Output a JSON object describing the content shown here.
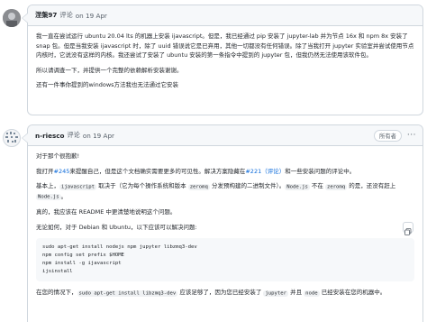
{
  "comment1": {
    "author": "涅槃97",
    "meta": "评论",
    "date": "on 19 Apr",
    "paragraphs": [
      "我一直在尝试运行 ubuntu 20.04 lts 的机器上安装 ijavascript。但是，我已经通过 pip 安装了 jupyter-lab 并为节点 16x 和 npm 8x 安装了 snap 包。但是当我安装 ijavascript 时，除了 uuid 错误说它是已弃用，其他一切都没有任何错误。除了当我打开 jupyter 实验室并尝试使用节点内核时，它说没有这样的内核。我还尝试了安装了 ubuntu 安装的第一条指令中提到的 jupyter 包，但我仍然无法使用该软件包。",
      "所以请调查一下，并提供一个完整的依赖解析安装谢谢。",
      "还有一件事你提到的windows方法我也无法通过它安装"
    ]
  },
  "comment2": {
    "author": "n-riesco",
    "meta": "评论",
    "date": "on 19 Apr",
    "badge": "所有者",
    "more_icon": "kebab-horizontal-icon",
    "p1": "对于那个很抱歉!",
    "p2_a": "我打开",
    "p2_link1": "#245",
    "p2_b": "来提醒自己，但是这个文档确实需要更多的可见性。解决方案隐藏在",
    "p2_link2": "#221（评论）",
    "p2_c": "和一些安装问题的评论中。",
    "p3_a": "基本上，",
    "p3_code1": "ijavascript",
    "p3_b": " 取决于（它为每个操作系统和版本 ",
    "p3_code2": "zeromq",
    "p3_c": " 分发预构建的二进制文件）。",
    "p3_code3": "Node.js",
    "p3_d": " 不在 ",
    "p3_code4": "zeromq",
    "p3_e": " 的是，还没有赶上 ",
    "p3_code5": "Node.js",
    "p3_f": "。",
    "p4": "真的，我应该在 README 中更清楚地说明这个问题。",
    "p5": "无论如何，对于 Debian 和 Ubuntu，以下应该可以解决问题:",
    "code_lines": [
      "sudo apt-get install nodejs npm jupyter libzmq3-dev",
      "npm config set prefix $HOME",
      "npm install -g ijavascript",
      "ijsinstall"
    ],
    "p6_a": "在您的情况下，",
    "p6_code1": "sudo apt-get install libzmq3-dev",
    "p6_b": " 应该足够了，因为您已经安装了 ",
    "p6_code2": "jupyter",
    "p6_c": " 并且 ",
    "p6_code3": "node",
    "p6_d": " 已经安装在您的机器中。"
  },
  "icons": {
    "copy": "copy-icon"
  }
}
